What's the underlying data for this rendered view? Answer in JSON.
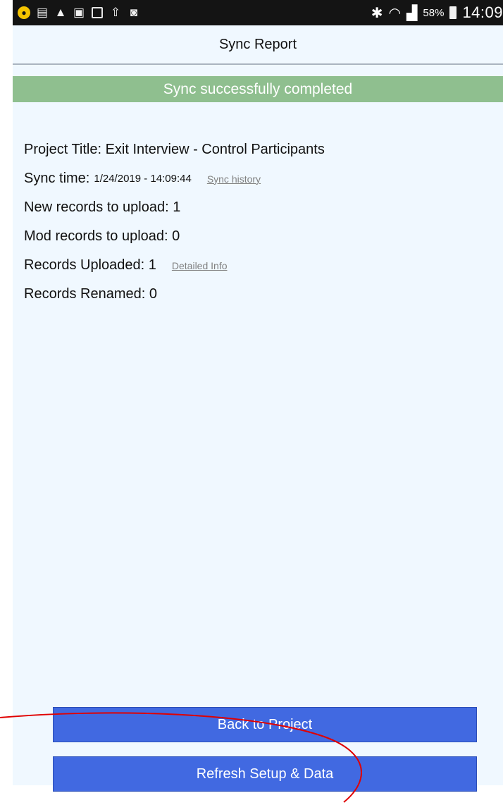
{
  "status_bar": {
    "left_icons": [
      "lock-circle-icon",
      "reader-icon",
      "warning-icon",
      "gallery-icon",
      "image-icon",
      "upload-icon",
      "shield-icon"
    ],
    "battery_percent": "58%",
    "time": "14:09"
  },
  "header": {
    "title": "Sync Report"
  },
  "banner": {
    "text": "Sync successfully completed",
    "color": "#8fbf8f"
  },
  "report": {
    "project_title": "Project Title: Exit Interview - Control Participants",
    "sync_time_label": "Sync time:",
    "sync_time_value": "1/24/2019 - 14:09:44",
    "sync_history_link": "Sync history",
    "new_records": "New records to upload: 1",
    "mod_records": "Mod records to upload: 0",
    "records_uploaded": "Records Uploaded: 1",
    "detailed_info_link": "Detailed Info",
    "records_renamed": "Records Renamed: 0"
  },
  "buttons": {
    "back_label": "Back to Project",
    "refresh_label": "Refresh Setup & Data",
    "color": "#4169e1"
  },
  "annotation": {
    "color": "#e00000"
  }
}
